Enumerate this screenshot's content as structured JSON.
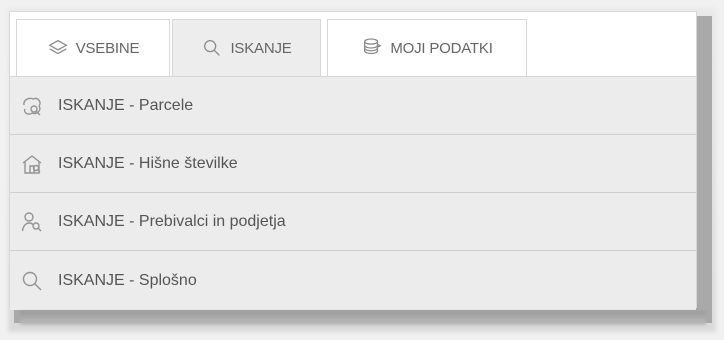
{
  "tabs": [
    {
      "label": "VSEBINE",
      "icon": "layers-icon"
    },
    {
      "label": "ISKANJE",
      "icon": "search-icon"
    },
    {
      "label": "MOJI PODATKI",
      "icon": "stack-icon"
    }
  ],
  "search_options": [
    {
      "label": "ISKANJE - Parcele",
      "icon": "parcel-icon"
    },
    {
      "label": "ISKANJE - Hišne številke",
      "icon": "house-icon"
    },
    {
      "label": "ISKANJE - Prebivalci in podjetja",
      "icon": "person-search-icon"
    },
    {
      "label": "ISKANJE - Splošno",
      "icon": "search-icon"
    }
  ],
  "colors": {
    "panel_background": "#ececec",
    "tab_active": "#ededed",
    "text": "#555555",
    "icon": "#949494",
    "border": "#cfcfcf"
  }
}
